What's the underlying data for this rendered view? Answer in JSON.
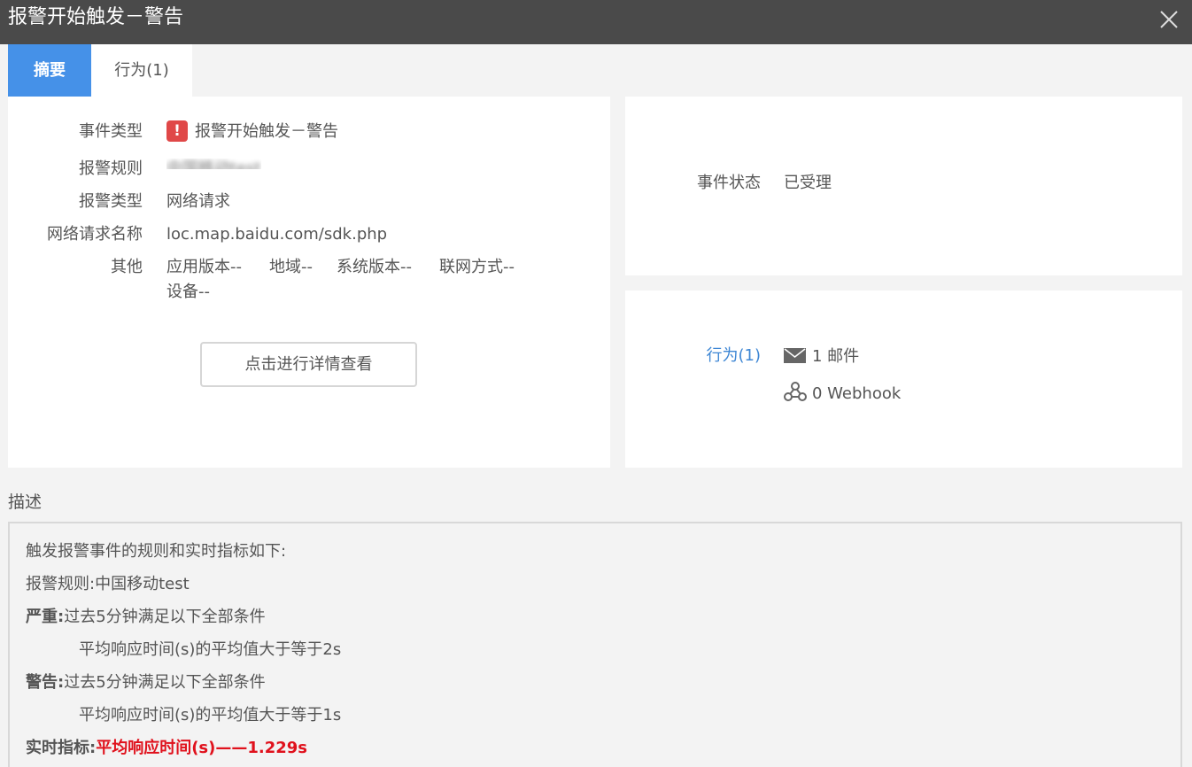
{
  "window": {
    "title": "报警开始触发－警告"
  },
  "tabs": [
    {
      "label": "摘要",
      "active": true
    },
    {
      "label": "行为(1)",
      "active": false
    }
  ],
  "summary": {
    "event_type_label": "事件类型",
    "event_type_value": "报警开始触发－警告",
    "alert_rule_label": "报警规则",
    "alert_rule_value": "中国移动test",
    "alert_type_label": "报警类型",
    "alert_type_value": "网络请求",
    "request_name_label": "网络请求名称",
    "request_name_value": "loc.map.baidu.com/sdk.php",
    "other_label": "其他",
    "other_items": [
      "应用版本--",
      "地域--",
      "系统版本--",
      "联网方式--",
      "设备--"
    ],
    "detail_button": "点击进行详情查看"
  },
  "status": {
    "label": "事件状态",
    "value": "已受理"
  },
  "actions": {
    "label": "行为(1)",
    "email": "1 邮件",
    "webhook": "0 Webhook"
  },
  "description": {
    "heading": "描述",
    "intro": "触发报警事件的规则和实时指标如下:",
    "rule_prefix": "报警规则:",
    "rule_value": "中国移动test",
    "severe_label": "严重:",
    "severe_condition": "过去5分钟满足以下全部条件",
    "severe_detail": "平均响应时间(s)的平均值大于等于2s",
    "warning_label": "警告:",
    "warning_condition": "过去5分钟满足以下全部条件",
    "warning_detail": "平均响应时间(s)的平均值大于等于1s",
    "metric_label": "实时指标:",
    "metric_value": "平均响应时间(s)——1.229s"
  },
  "icons": {
    "close": "close-icon",
    "error": "alert-error-icon",
    "email": "envelope-icon",
    "webhook": "webhook-icon"
  },
  "colors": {
    "titlebar": "#4a4a4a",
    "tab_active": "#4591e8",
    "error_red": "#e04848",
    "metric_red": "#e0111c",
    "link_blue": "#3d86d4"
  }
}
